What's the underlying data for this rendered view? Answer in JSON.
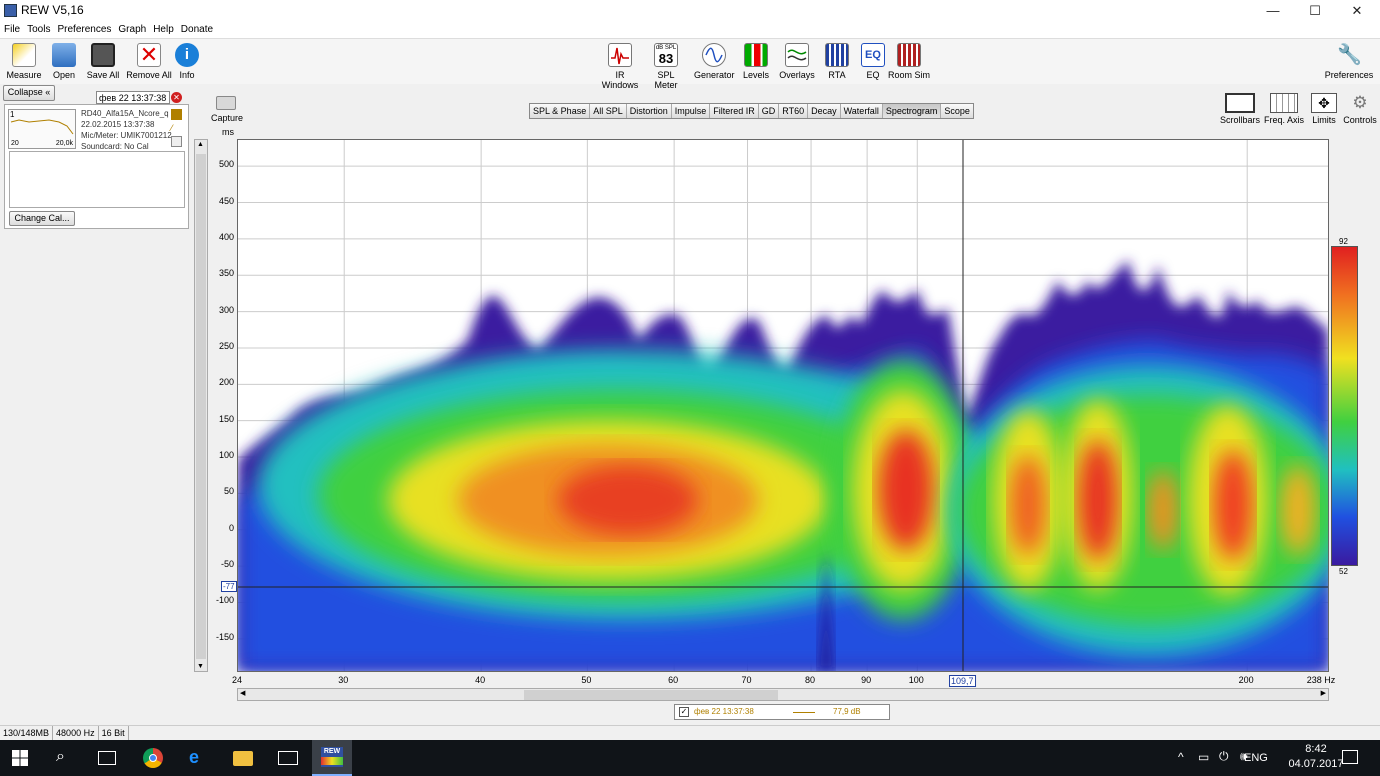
{
  "window": {
    "title": "REW V5,16",
    "minimize": "—",
    "maximize": "☐",
    "close": "✕"
  },
  "menu": [
    "File",
    "Tools",
    "Preferences",
    "Graph",
    "Help",
    "Donate"
  ],
  "toolbar_left": [
    {
      "label": "Measure",
      "icon": "measure-icon"
    },
    {
      "label": "Open",
      "icon": "folder-icon"
    },
    {
      "label": "Save All",
      "icon": "save-icon"
    },
    {
      "label": "Remove All",
      "icon": "remove-icon"
    },
    {
      "label": "Info",
      "icon": "info-icon"
    }
  ],
  "toolbar_center": [
    {
      "label": "IR Windows",
      "icon": "ir-windows-icon"
    },
    {
      "label": "SPL Meter",
      "icon": "spl-meter-icon",
      "value": "83",
      "sub": "dB SPL"
    },
    {
      "label": "Generator",
      "icon": "generator-icon"
    },
    {
      "label": "Levels",
      "icon": "levels-icon"
    },
    {
      "label": "Overlays",
      "icon": "overlays-icon"
    },
    {
      "label": "RTA",
      "icon": "rta-icon"
    },
    {
      "label": "EQ",
      "icon": "eq-icon"
    },
    {
      "label": "Room Sim",
      "icon": "room-sim-icon"
    }
  ],
  "preferences_label": "Preferences",
  "collapse_label": "Collapse",
  "measurement": {
    "name_field": "фев 22 13:37:38",
    "lines": [
      "RD40_Alfa15A_Ncore_q",
      "22.02.2015 13:37:38",
      "Mic/Meter: UMIK7001212",
      "Soundcard: No Cal"
    ],
    "thumb_left": "20",
    "thumb_right": "20,0k",
    "thumb_num": "1"
  },
  "change_cal_label": "Change Cal...",
  "capture_label": "Capture",
  "tabs": [
    "SPL & Phase",
    "All SPL",
    "Distortion",
    "Impulse",
    "Filtered IR",
    "GD",
    "RT60",
    "Decay",
    "Waterfall",
    "Spectrogram",
    "Scope"
  ],
  "active_tab": "Spectrogram",
  "right_tools": [
    {
      "label": "Scrollbars",
      "icon": "scrollbars-icon"
    },
    {
      "label": "Freq. Axis",
      "icon": "freq-axis-icon"
    },
    {
      "label": "Limits",
      "icon": "limits-icon"
    },
    {
      "label": "Controls",
      "icon": "gear-icon"
    }
  ],
  "graph": {
    "y_unit": "ms",
    "y_ticks": [
      "500",
      "450",
      "400",
      "350",
      "300",
      "250",
      "200",
      "150",
      "100",
      "50",
      "0",
      "-50",
      "-100",
      "-150"
    ],
    "x_ticks": [
      "24",
      "30",
      "40",
      "50",
      "60",
      "70",
      "80",
      "90",
      "100",
      "200",
      "238 Hz"
    ],
    "cursor_x_label": "109,7",
    "cursor_y_label": "-77",
    "scale_max": "92",
    "scale_min": "52"
  },
  "legend": {
    "name": "фев 22 13:37:38",
    "value": "77,9 dB"
  },
  "status": [
    "130/148MB",
    "48000 Hz",
    "16 Bit"
  ],
  "taskbar": {
    "lang": "ENG",
    "time": "8:42",
    "date": "04.07.2017",
    "rew_badge": "REW"
  },
  "colors": {
    "accent": "#2a5ca8",
    "plot_border": "#666666"
  }
}
